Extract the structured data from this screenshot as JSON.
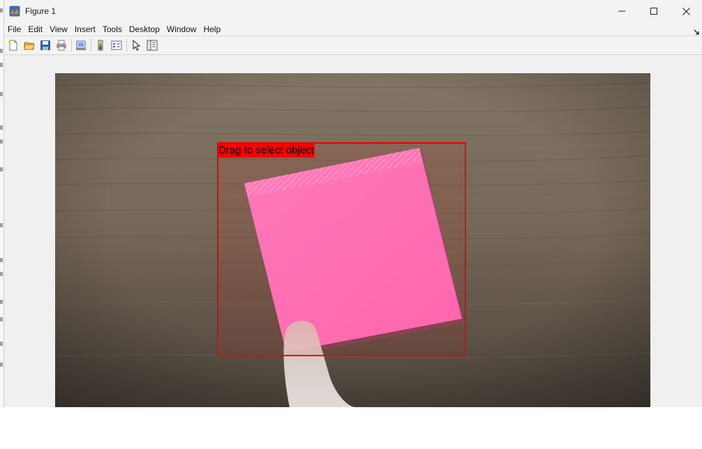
{
  "window": {
    "title": "Figure 1",
    "controls": {
      "minimize": "—",
      "maximize": "☐",
      "close": "✕"
    }
  },
  "menubar": {
    "items": [
      "File",
      "Edit",
      "View",
      "Insert",
      "Tools",
      "Desktop",
      "Window",
      "Help"
    ]
  },
  "toolbar": {
    "buttons": [
      {
        "icon": "new-figure-icon"
      },
      {
        "icon": "open-file-icon"
      },
      {
        "icon": "save-icon"
      },
      {
        "icon": "print-icon"
      },
      {
        "icon": "link-plot-icon"
      },
      {
        "icon": "colorbar-icon"
      },
      {
        "icon": "legend-icon"
      },
      {
        "icon": "edit-plot-icon"
      },
      {
        "icon": "property-inspector-icon"
      }
    ]
  },
  "figure": {
    "roi_label": "Drag to select object",
    "roi_color": "#ff0000"
  },
  "colors": {
    "titlebar": "#f3f3f3",
    "figure_background": "#f0f0f0",
    "sticky_note": "#ff77c4",
    "table_wood": "#6b5e52"
  }
}
